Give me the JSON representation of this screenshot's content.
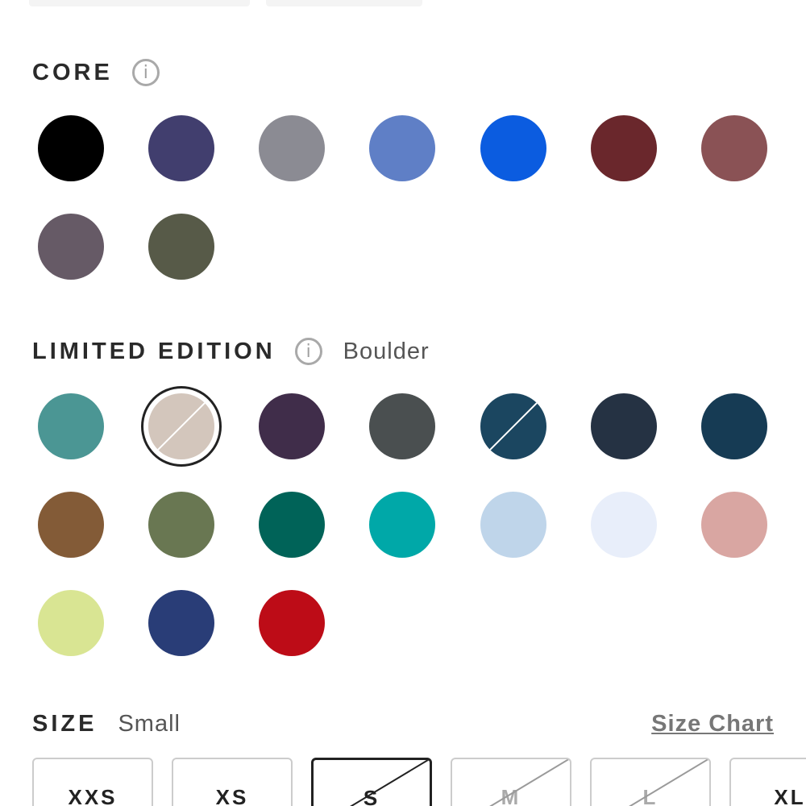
{
  "core": {
    "title": "CORE",
    "swatches": [
      {
        "name": "color-swatch",
        "color": "#000000"
      },
      {
        "name": "color-swatch",
        "color": "#413e6e"
      },
      {
        "name": "color-swatch",
        "color": "#8b8b93"
      },
      {
        "name": "color-swatch",
        "color": "#5f7fc6"
      },
      {
        "name": "color-swatch",
        "color": "#0b5ce0"
      },
      {
        "name": "color-swatch",
        "color": "#6a272c"
      },
      {
        "name": "color-swatch",
        "color": "#8a5255"
      },
      {
        "name": "color-swatch",
        "color": "#665a66"
      },
      {
        "name": "color-swatch",
        "color": "#575a48"
      }
    ]
  },
  "limited": {
    "title": "LIMITED EDITION",
    "selected_name": "Boulder",
    "swatches": [
      {
        "color": "#4b9694",
        "selected": false,
        "unavailable": false
      },
      {
        "color": "#d3c6bc",
        "selected": true,
        "unavailable": true
      },
      {
        "color": "#402d4a",
        "selected": false,
        "unavailable": false
      },
      {
        "color": "#4a4f50",
        "selected": false,
        "unavailable": false
      },
      {
        "color": "#1b4660",
        "selected": false,
        "unavailable": true
      },
      {
        "color": "#253243",
        "selected": false,
        "unavailable": false
      },
      {
        "color": "#163b54",
        "selected": false,
        "unavailable": false
      },
      {
        "color": "#835b37",
        "selected": false,
        "unavailable": false
      },
      {
        "color": "#697752",
        "selected": false,
        "unavailable": false
      },
      {
        "color": "#006358",
        "selected": false,
        "unavailable": false
      },
      {
        "color": "#00a8a8",
        "selected": false,
        "unavailable": false
      },
      {
        "color": "#bfd5ea",
        "selected": false,
        "unavailable": false
      },
      {
        "color": "#e8eefa",
        "selected": false,
        "unavailable": false
      },
      {
        "color": "#d9a6a2",
        "selected": false,
        "unavailable": false
      },
      {
        "color": "#d9e593",
        "selected": false,
        "unavailable": false
      },
      {
        "color": "#293d77",
        "selected": false,
        "unavailable": false
      },
      {
        "color": "#bd0c17",
        "selected": false,
        "unavailable": false
      }
    ]
  },
  "size": {
    "title": "SIZE",
    "selected_name": "Small",
    "chart_label": "Size Chart",
    "options": [
      {
        "label": "XXS",
        "selected": false,
        "unavailable": false
      },
      {
        "label": "XS",
        "selected": false,
        "unavailable": false
      },
      {
        "label": "S",
        "selected": true,
        "unavailable": true
      },
      {
        "label": "M",
        "selected": false,
        "unavailable": true
      },
      {
        "label": "L",
        "selected": false,
        "unavailable": true
      },
      {
        "label": "XL",
        "selected": false,
        "unavailable": false
      }
    ]
  },
  "icons": {
    "info": "info-icon"
  }
}
